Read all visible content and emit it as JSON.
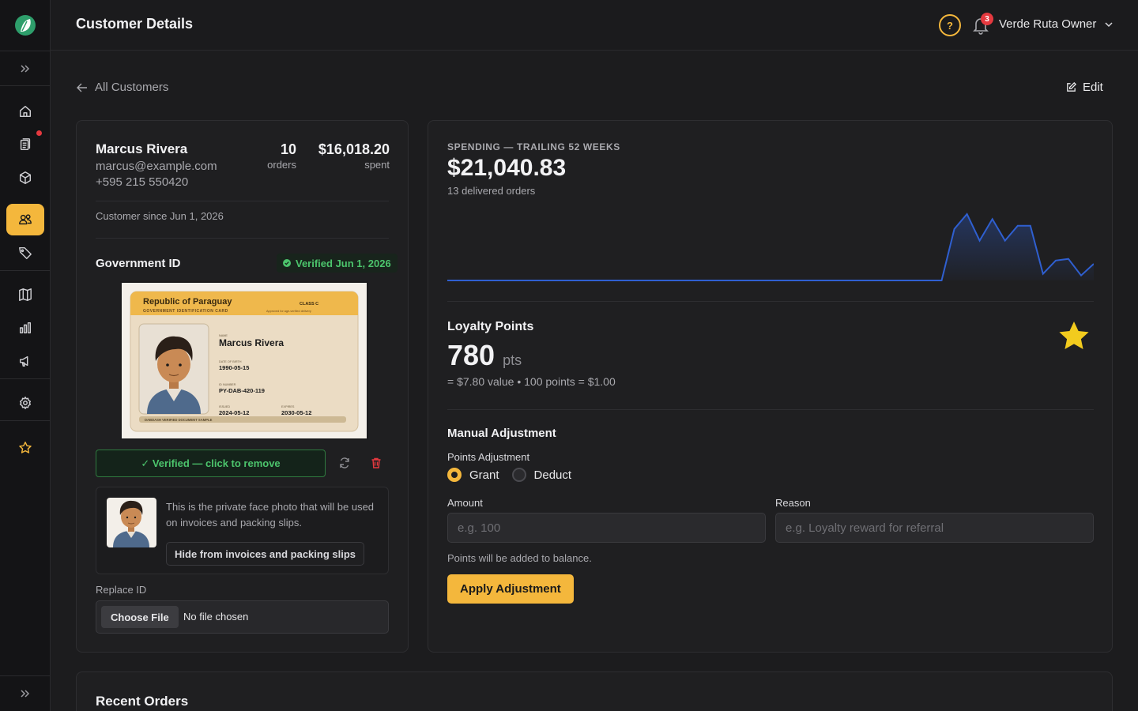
{
  "header": {
    "title": "Customer Details",
    "help_label": "?",
    "notification_count": "3",
    "user_name": "Verde Ruta Owner"
  },
  "nav": {
    "back_label": "All Customers",
    "edit_label": "Edit",
    "items": [
      "home-icon",
      "orders-icon",
      "products-icon",
      "customers-icon",
      "tags-icon",
      "catalog-icon",
      "analytics-icon",
      "marketing-icon",
      "settings-icon",
      "favorites-icon"
    ]
  },
  "customer": {
    "name": "Marcus Rivera",
    "email": "marcus@example.com",
    "phone": "+595 215 550420",
    "orders_count": "10",
    "orders_label": "orders",
    "spent": "$16,018.20",
    "spent_label": "spent",
    "since": "Customer since Jun 1, 2026"
  },
  "gov_id": {
    "title": "Government ID",
    "verified_badge": "Verified Jun 1, 2026",
    "card": {
      "country": "Republic of Paraguay",
      "card_type": "GOVERNMENT IDENTIFICATION CARD",
      "class": "CLASS C",
      "approval": "Approved for age-verified delivery",
      "name_label": "NAME",
      "name": "Marcus Rivera",
      "dob_label": "DATE OF BIRTH",
      "dob": "1990-05-15",
      "id_label": "ID NUMBER",
      "id_number": "PY-DAB-420-119",
      "issued_label": "ISSUED",
      "issued": "2024-05-12",
      "expires_label": "EXPIRES",
      "expires": "2030-05-12",
      "footer": "DABDASH VERIFIED DOCUMENT SAMPLE"
    },
    "verified_button": "✓ Verified — click to remove",
    "face_text": "This is the private face photo that will be used on invoices and packing slips.",
    "hide_button": "Hide from invoices and packing slips",
    "replace_label": "Replace ID",
    "choose_file": "Choose File",
    "no_file": "No file chosen"
  },
  "spending": {
    "label": "SPENDING — TRAILING 52 WEEKS",
    "total": "$21,040.83",
    "sub": "13 delivered orders",
    "color": "#2f5fd0"
  },
  "chart_data": {
    "type": "area",
    "title": "SPENDING — TRAILING 52 WEEKS",
    "x": [
      1,
      2,
      3,
      4,
      5,
      6,
      7,
      8,
      9,
      10,
      11,
      12,
      13,
      14,
      15,
      16,
      17,
      18,
      19,
      20,
      21,
      22,
      23,
      24,
      25,
      26,
      27,
      28,
      29,
      30,
      31,
      32,
      33,
      34,
      35,
      36,
      37,
      38,
      39,
      40,
      41,
      42,
      43,
      44,
      45,
      46,
      47,
      48,
      49,
      50,
      51,
      52
    ],
    "values": [
      0,
      0,
      0,
      0,
      0,
      0,
      0,
      0,
      0,
      0,
      0,
      0,
      0,
      0,
      0,
      0,
      0,
      0,
      0,
      0,
      0,
      0,
      0,
      0,
      0,
      0,
      0,
      0,
      0,
      0,
      0,
      0,
      0,
      0,
      0,
      0,
      0,
      0,
      0,
      0,
      3100,
      4000,
      2400,
      3700,
      2400,
      3300,
      3300,
      400,
      1200,
      1300,
      300,
      1000
    ],
    "xlabel": "",
    "ylabel": "",
    "grid": false
  },
  "loyalty": {
    "title": "Loyalty Points",
    "points": "780",
    "unit": "pts",
    "sub": "= $7.80 value  •  100 points = $1.00"
  },
  "adjustment": {
    "title": "Manual Adjustment",
    "points_label": "Points Adjustment",
    "grant": "Grant",
    "deduct": "Deduct",
    "amount_label": "Amount",
    "amount_placeholder": "e.g. 100",
    "reason_label": "Reason",
    "reason_placeholder": "e.g. Loyalty reward for referral",
    "hint": "Points will be added to balance.",
    "apply": "Apply Adjustment"
  },
  "recent": {
    "title": "Recent Orders"
  }
}
